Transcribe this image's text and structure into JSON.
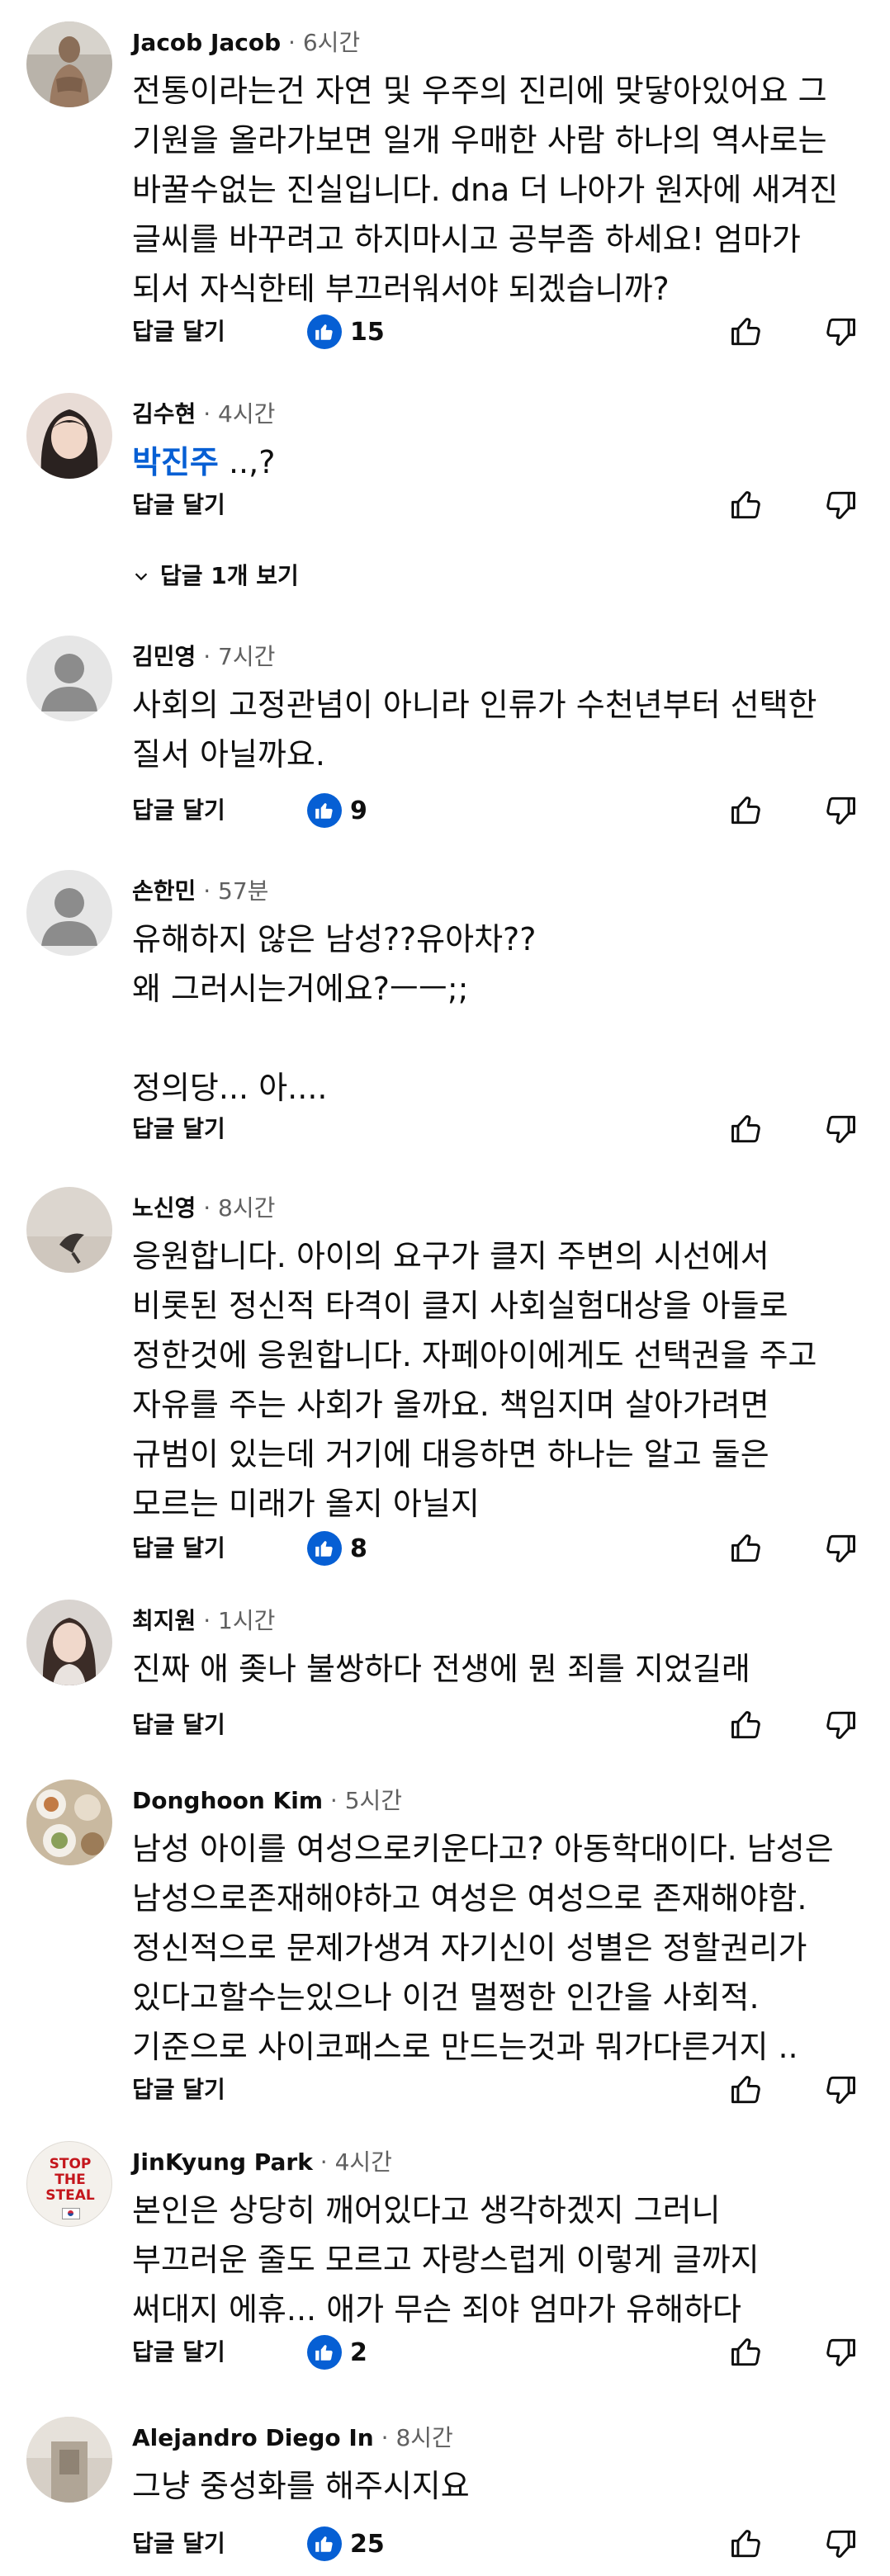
{
  "ui": {
    "reply_label": "답글 달기",
    "like_count_icon": "thumbs-up-filled-icon",
    "like_icon": "thumbs-up-outline-icon",
    "dislike_icon": "thumbs-down-outline-icon",
    "accent_color": "#065fd4"
  },
  "comments": [
    {
      "author": "Jacob Jacob",
      "time": "6시간",
      "text": "전통이라는건 자연 및 우주의 진리에 맞닿아있어요 그\n기원을 올라가보면 일개 우매한 사람 하나의 역사로는\n바꿀수없는 진실입니다. dna 더 나아가 원자에 새겨진\n글씨를 바꾸려고 하지마시고 공부좀 하세요! 엄마가\n되서 자식한테 부끄러워서야 되겠습니까?",
      "likes": "15"
    },
    {
      "author": "김수현",
      "time": "4시간",
      "mention": "박진주",
      "text": " ..,?",
      "likes": "",
      "replies_toggle": "답글 1개 보기"
    },
    {
      "author": "김민영",
      "time": "7시간",
      "text": "사회의 고정관념이 아니라 인류가 수천년부터 선택한\n질서 아닐까요.",
      "likes": "9"
    },
    {
      "author": "손한민",
      "time": "57분",
      "text": "유해하지 않은 남성??유아차??\n왜 그러시는거에요?ㅡㅡ;;\n\n정의당... 아....",
      "likes": ""
    },
    {
      "author": "노신영",
      "time": "8시간",
      "text": "응원합니다. 아이의 요구가 클지 주변의 시선에서\n비롯된 정신적 타격이 클지 사회실험대상을 아들로\n정한것에 응원합니다. 자페아이에게도 선택권을 주고\n자유를 주는 사회가 올까요. 책임지며 살아가려면\n규범이 있는데 거기에 대응하면 하나는 알고 둘은\n모르는 미래가 올지 아닐지",
      "likes": "8"
    },
    {
      "author": "최지원",
      "time": "1시간",
      "text": "진짜 애 좆나 불쌍하다 전생에 뭔 죄를 지었길래",
      "likes": ""
    },
    {
      "author": "Donghoon Kim",
      "time": "5시간",
      "text": "남성 아이를 여성으로키운다고? 아동학대이다. 남성은\n남성으로존재해야하고 여성은 여성으로 존재해야함.\n정신적으로 문제가생겨 자기신이 성별은 정할권리가\n있다고할수는있으나 이건 멀쩡한 인간을 사회적.\n기준으로 사이코패스로 만드는것과 뭐가다른거지 ..",
      "likes": ""
    },
    {
      "author": "JinKyung Park",
      "time": "4시간",
      "text": "본인은 상당히 깨어있다고 생각하겠지 그러니\n부끄러운 줄도 모르고 자랑스럽게 이렇게 글까지\n써대지 에휴... 애가 무슨 죄야 엄마가 유해하다",
      "likes": "2",
      "avatar_text": [
        "STOP",
        "THE",
        "STEAL"
      ]
    },
    {
      "author": "Alejandro Diego In",
      "time": "8시간",
      "text": "그냥 중성화를 해주시지요",
      "likes": "25"
    }
  ]
}
